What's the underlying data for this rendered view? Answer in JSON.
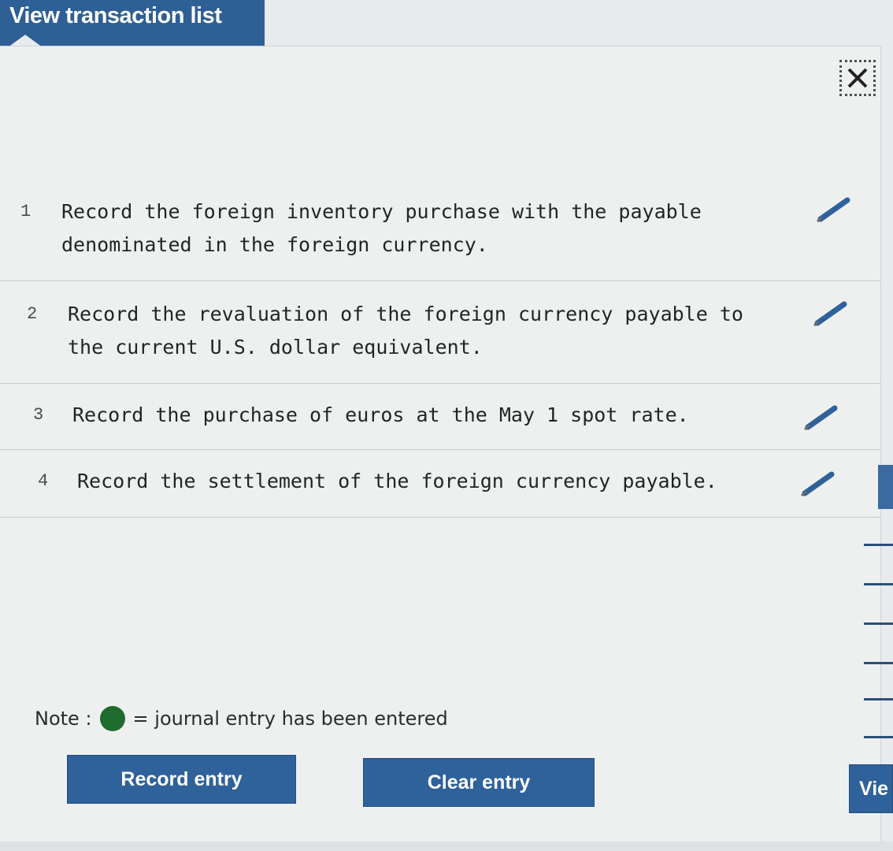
{
  "header": {
    "tab_label": "View transaction list"
  },
  "close": {
    "glyph": "✕"
  },
  "transactions": [
    {
      "number": "1",
      "text": "Record the foreign inventory purchase with the payable\ndenominated in the foreign currency.",
      "icon": "pencil-icon"
    },
    {
      "number": "2",
      "text": "Record the revaluation of the foreign currency payable to\nthe current U.S. dollar equivalent.",
      "icon": "pencil-icon"
    },
    {
      "number": "3",
      "text": "Record the purchase of euros at the May 1 spot rate.",
      "icon": "pencil-icon"
    },
    {
      "number": "4",
      "text": "Record the settlement of the foreign currency payable.",
      "icon": "pencil-icon"
    }
  ],
  "note": {
    "prefix": "Note :",
    "suffix": "= journal entry has been entered",
    "dot_color": "#1f6b2d"
  },
  "buttons": {
    "record": "Record entry",
    "clear": "Clear entry",
    "view": "Vie"
  },
  "colors": {
    "accent": "#2f619a",
    "pencil": "#2f619a"
  }
}
